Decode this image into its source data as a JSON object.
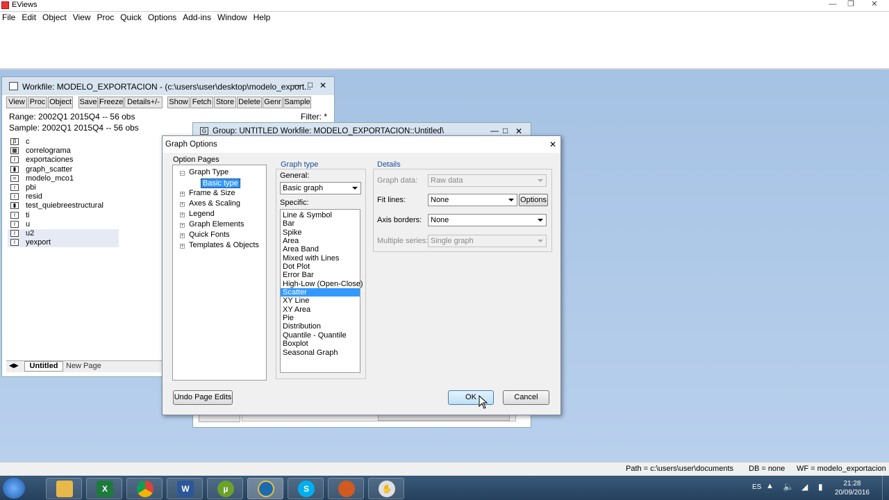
{
  "app": {
    "title": "EViews"
  },
  "menubar": [
    "File",
    "Edit",
    "Object",
    "View",
    "Proc",
    "Quick",
    "Options",
    "Add-ins",
    "Window",
    "Help"
  ],
  "workfile": {
    "title": "Workfile: MODELO_EXPORTACION - (c:\\users\\user\\desktop\\modelo_export...",
    "toolbar": [
      "View",
      "Proc",
      "Object",
      "Save",
      "Freeze",
      "Details+/-",
      "Show",
      "Fetch",
      "Store",
      "Delete",
      "Genr",
      "Sample"
    ],
    "range": "Range:  2002Q1 2015Q4   --   56 obs",
    "sample": "Sample: 2002Q1 2015Q4   --   56 obs",
    "filter": "Filter: *",
    "objects": [
      {
        "name": "c",
        "icon": "coef-icon"
      },
      {
        "name": "correlograma",
        "icon": "table-icon"
      },
      {
        "name": "exportaciones",
        "icon": "series-icon"
      },
      {
        "name": "graph_scatter",
        "icon": "graph-icon"
      },
      {
        "name": "modelo_mco1",
        "icon": "equation-icon"
      },
      {
        "name": "pbi",
        "icon": "series-icon"
      },
      {
        "name": "resid",
        "icon": "series-icon"
      },
      {
        "name": "test_quiebreestructural",
        "icon": "graph-icon"
      },
      {
        "name": "ti",
        "icon": "series-icon"
      },
      {
        "name": "u",
        "icon": "series-icon"
      },
      {
        "name": "u2",
        "icon": "series-icon"
      },
      {
        "name": "yexport",
        "icon": "series-icon"
      }
    ],
    "tabs": [
      "Untitled",
      "New Page"
    ]
  },
  "group": {
    "title": "Group: UNTITLED   Workfile: MODELO_EXPORTACION::Untitled\\"
  },
  "dialog": {
    "title": "Graph Options",
    "option_pages_label": "Option Pages",
    "tree": [
      "Graph Type",
      "Basic type",
      "Frame & Size",
      "Axes & Scaling",
      "Legend",
      "Graph Elements",
      "Quick Fonts",
      "Templates & Objects"
    ],
    "graph_type_label": "Graph type",
    "general_label": "General:",
    "general_value": "Basic graph",
    "specific_label": "Specific:",
    "specific_items": [
      "Line & Symbol",
      "Bar",
      "Spike",
      "Area",
      "Area Band",
      "Mixed with Lines",
      "Dot Plot",
      "Error Bar",
      "High-Low (Open-Close)",
      "Scatter",
      "XY Line",
      "XY Area",
      "Pie",
      "Distribution",
      "Quantile - Quantile",
      "Boxplot",
      "Seasonal Graph"
    ],
    "specific_selected": "Scatter",
    "details_label": "Details",
    "graph_data_label": "Graph data:",
    "graph_data_value": "Raw data",
    "fit_lines_label": "Fit lines:",
    "fit_lines_value": "None",
    "options_button": "Options",
    "axis_borders_label": "Axis borders:",
    "axis_borders_value": "None",
    "multiple_series_label": "Multiple series:",
    "multiple_series_value": "Single graph",
    "undo_button": "Undo Page Edits",
    "ok_button": "OK",
    "cancel_button": "Cancel"
  },
  "statusbar": {
    "path": "Path = c:\\users\\user\\documents",
    "db": "DB = none",
    "wf": "WF = modelo_exportacion"
  },
  "taskbar": {
    "lang": "ES",
    "time": "21:28",
    "date": "20/09/2016"
  }
}
